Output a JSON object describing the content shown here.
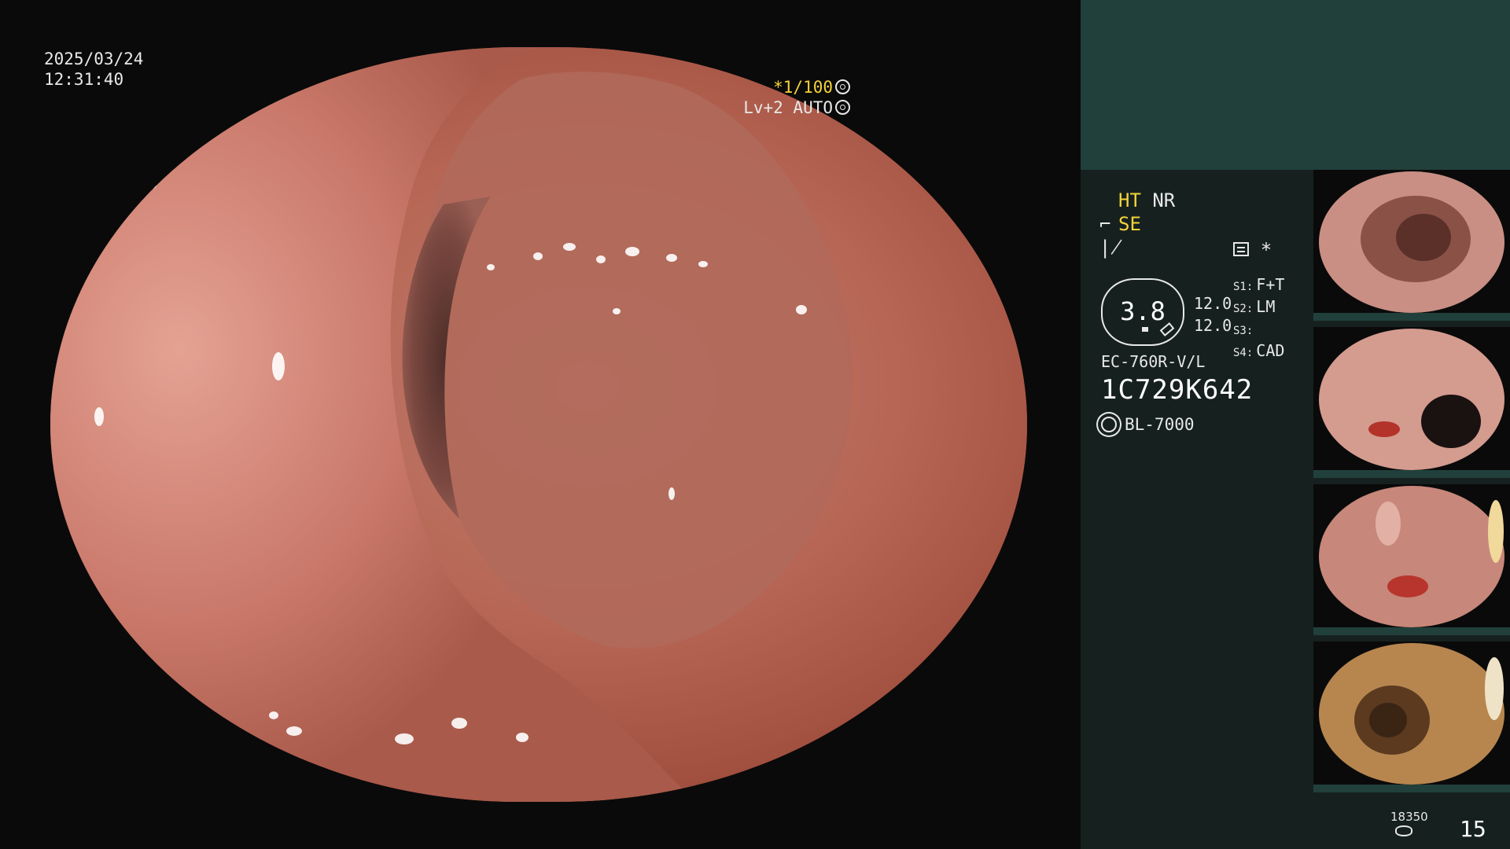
{
  "overlay": {
    "date": "2025/03/24",
    "time": "12:31:40",
    "shutter_prefix": "*",
    "shutter": "1/100",
    "level": "Lv+2",
    "mode": "AUTO"
  },
  "panel": {
    "ht": "HT",
    "nr": "NR",
    "se": "SE",
    "gauge_value": "3.8",
    "gauge_val1": "12.0",
    "gauge_val2": "12.0",
    "switches": [
      {
        "label": "S1:",
        "value": "F+T"
      },
      {
        "label": "S2:",
        "value": "LM"
      },
      {
        "label": "S3:",
        "value": ""
      },
      {
        "label": "S4:",
        "value": "CAD"
      }
    ],
    "asterisk": "*",
    "scope_model": "EC-760R-V/L",
    "serial": "1C729K642",
    "light_source": "BL-7000",
    "storage_count": "18350",
    "image_count": "15"
  },
  "colors": {
    "panel_bg": "#16211f",
    "panel_header": "#21403b",
    "accent_yellow": "#f4d23a"
  }
}
